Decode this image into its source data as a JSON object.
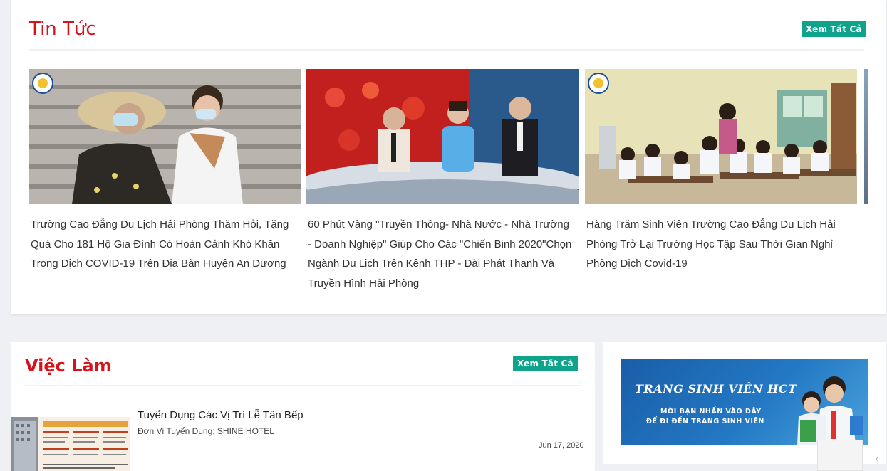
{
  "news": {
    "title": "Tin Tức",
    "see_all": "Xem Tất Cả",
    "items": [
      {
        "headline": "Trường Cao Đẳng Du Lịch Hải Phòng Thăm Hỏi, Tặng Quà Cho 181 Hộ Gia Đình Có Hoàn Cảnh Khó Khăn Trong Dịch COVID-19 Trên Địa Bàn Huyện An Dương"
      },
      {
        "headline": "60 Phút Vàng \"Truyền Thông- Nhà Nước - Nhà Trường - Doanh Nghiệp\" Giúp Cho Các \"Chiến Binh 2020\"Chọn Ngành Du Lịch Trên Kênh THP - Đài Phát Thanh Và Truyền Hình Hải Phòng"
      },
      {
        "headline": "Hàng Trăm Sinh Viên Trường Cao Đẳng Du Lịch Hải Phòng Trở Lại Trường Học Tập Sau Thời Gian Nghỉ Phòng Dịch Covid-19"
      }
    ]
  },
  "jobs": {
    "title": "Việc Làm",
    "see_all": "Xem Tất Cả",
    "items": [
      {
        "title": "Tuyển Dụng Các Vị Trí Lễ Tân Bếp",
        "company": "Đơn Vị Tuyển Dụng: SHINE HOTEL",
        "date": "Jun 17, 2020"
      }
    ]
  },
  "banner": {
    "title": "TRANG SINH VIÊN HCT",
    "line1": "MỜI BẠN NHẤN VÀO ĐÂY",
    "line2": "ĐỂ ĐI ĐẾN TRANG SINH VIÊN"
  },
  "icons": {
    "scroll": "chevron-left-icon"
  },
  "colors": {
    "heading": "#d6131b",
    "accent": "#0fa38c",
    "banner": "#1a5ea8"
  }
}
